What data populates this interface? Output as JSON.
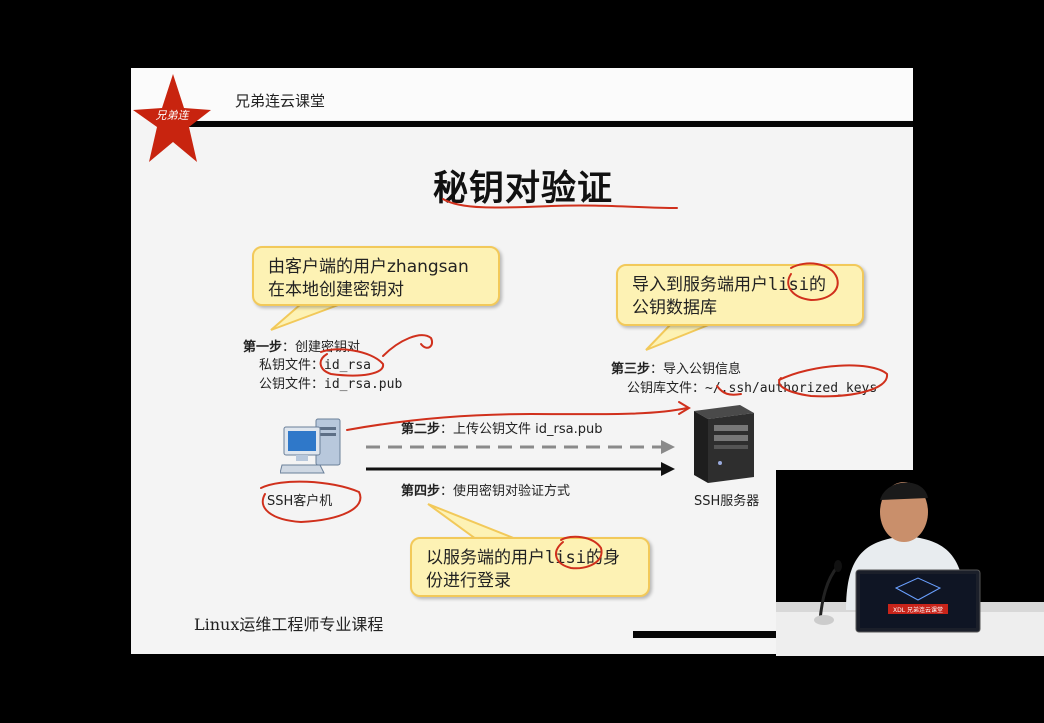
{
  "brand": {
    "name": "兄弟连云课堂",
    "logo_text": "兄弟连"
  },
  "slide": {
    "title": "秘钥对验证",
    "callout_client_line1": "由客户端的用户zhangsan",
    "callout_client_line2": "在本地创建密钥对",
    "callout_server_line1_a": "导入到服务端用户",
    "callout_server_line1_user": "lisi",
    "callout_server_line1_b": "的",
    "callout_server_line2": "公钥数据库",
    "callout_login_line1_a": "以服务端的用户",
    "callout_login_line1_user": "lisi",
    "callout_login_line1_b": "的身",
    "callout_login_line2": "份进行登录",
    "step1_title": "第一步",
    "step1_desc": "：创建密钥对",
    "step1_private_label": "私钥文件：",
    "step1_private_value": "id_rsa",
    "step1_public_label": "公钥文件：",
    "step1_public_value": "id_rsa.pub",
    "step2_title": "第二步",
    "step2_desc": "：上传公钥文件 id_rsa.pub",
    "step3_title": "第三步",
    "step3_desc": "：导入公钥信息",
    "step3_db_label": "公钥库文件：",
    "step3_db_value": "~/.ssh/authorized_keys",
    "step4_title": "第四步",
    "step4_desc": "：使用密钥对验证方式",
    "client_label": "SSH客户机",
    "server_label": "SSH服务器",
    "footer_course": "Linux运维工程师专业课程"
  },
  "presenter": {
    "laptop_label": "XDL 兄弟连云课堂"
  },
  "colors": {
    "callout_bg": "#fdf2b4",
    "callout_border": "#f2c95a",
    "ink": "#d0301c",
    "rule": "#050505"
  }
}
